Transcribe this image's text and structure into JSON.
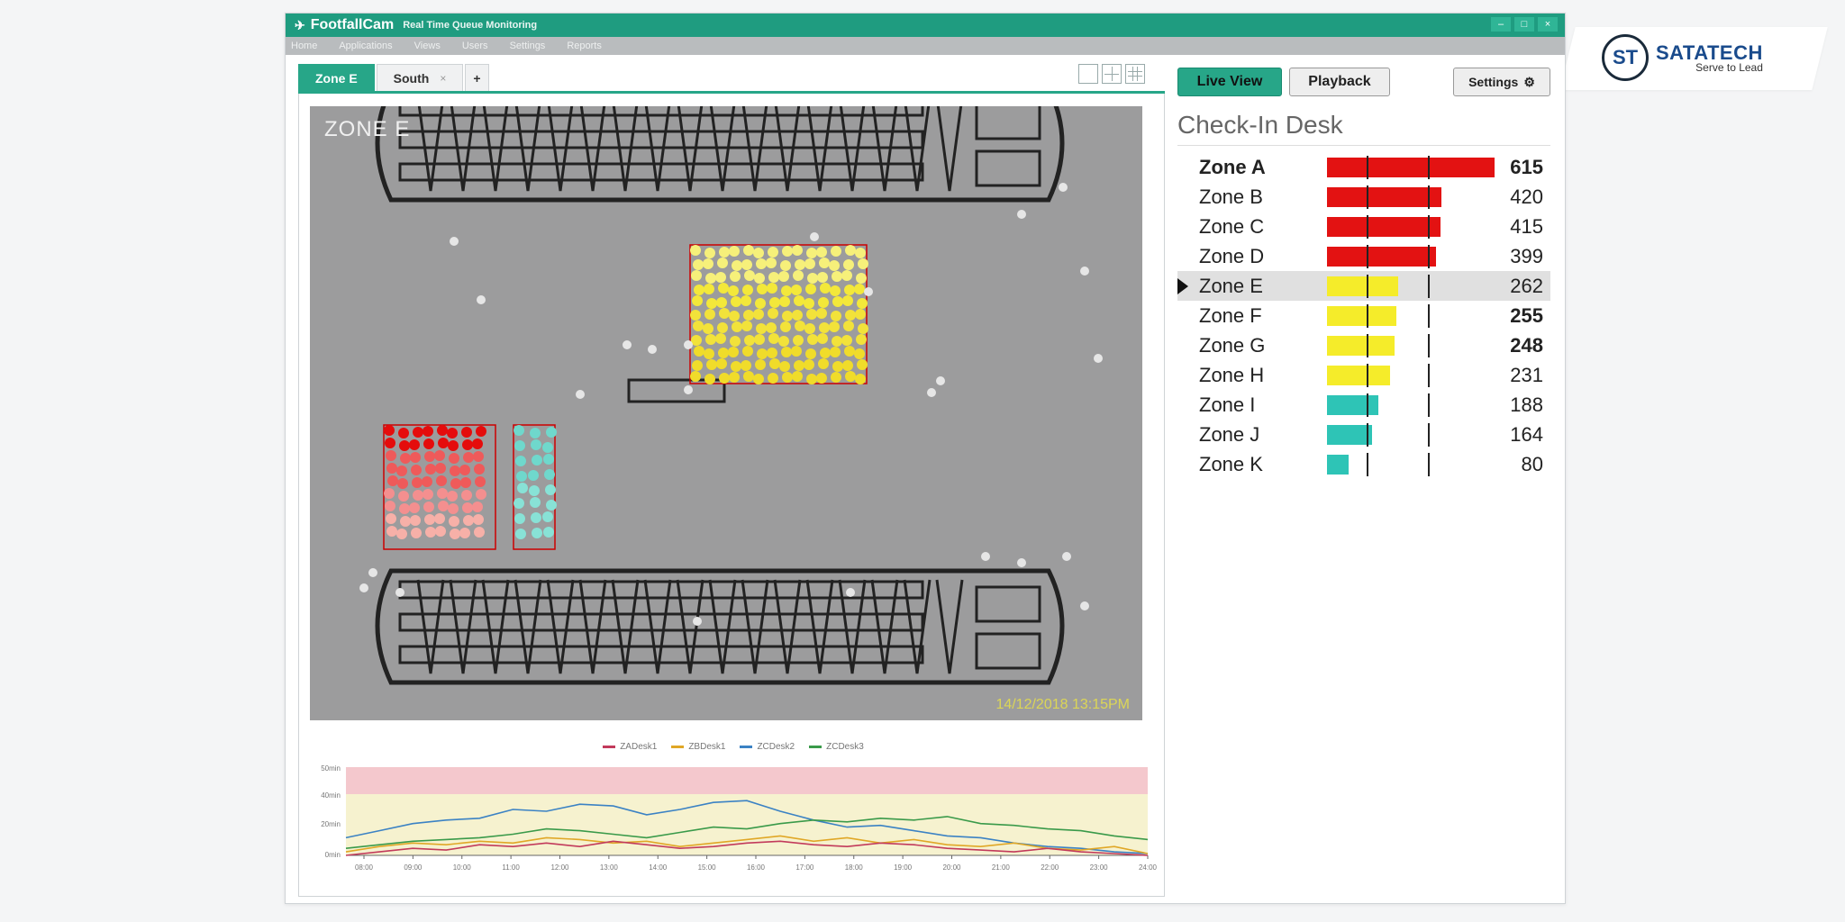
{
  "app": {
    "brand": "FootfallCam",
    "subtitle": "Real Time Queue Monitoring",
    "window_controls": [
      "–",
      "□",
      "×"
    ]
  },
  "menu": [
    "Home",
    "Applications",
    "Views",
    "Users",
    "Settings",
    "Reports"
  ],
  "tabs": [
    {
      "label": "Zone E",
      "active": true
    },
    {
      "label": "South",
      "close": "×"
    },
    {
      "label": "+"
    }
  ],
  "map": {
    "zone_label": "ZONE E",
    "timestamp": "14/12/2018 13:15PM"
  },
  "chart": {
    "legend": [
      "ZADesk1",
      "ZBDesk1",
      "ZCDesk2",
      "ZCDesk3"
    ],
    "y_labels": [
      "50min",
      "40min",
      "20min",
      "0min"
    ],
    "x_labels": [
      "08:00",
      "09:00",
      "10:00",
      "11:00",
      "12:00",
      "13:00",
      "14:00",
      "15:00",
      "16:00",
      "17:00",
      "18:00",
      "19:00",
      "20:00",
      "21:00",
      "22:00",
      "23:00",
      "24:00"
    ],
    "colors": {
      "ZADesk1": "#c23a5b",
      "ZBDesk1": "#e0a726",
      "ZCDesk2": "#3b82c4",
      "ZCDesk3": "#3a9a4a"
    }
  },
  "controls": {
    "live_view": "Live View",
    "playback": "Playback",
    "settings": "Settings"
  },
  "section_title": "Check-In Desk",
  "zones": [
    {
      "name": "Zone A",
      "value": "615",
      "color": "#e31212",
      "weight": "bold"
    },
    {
      "name": "Zone B",
      "value": "420",
      "color": "#e31212"
    },
    {
      "name": "Zone C",
      "value": "415",
      "color": "#e31212"
    },
    {
      "name": "Zone D",
      "value": "399",
      "color": "#e31212"
    },
    {
      "name": "Zone E",
      "value": "262",
      "color": "#f5ec2a",
      "selected": true
    },
    {
      "name": "Zone F",
      "value": "255",
      "color": "#f5ec2a",
      "weight": "boldval"
    },
    {
      "name": "Zone G",
      "value": "248",
      "color": "#f5ec2a",
      "weight": "boldval"
    },
    {
      "name": "Zone H",
      "value": "231",
      "color": "#f5ec2a"
    },
    {
      "name": "Zone I",
      "value": "188",
      "color": "#2ec4b6"
    },
    {
      "name": "Zone J",
      "value": "164",
      "color": "#2ec4b6"
    },
    {
      "name": "Zone K",
      "value": "80",
      "color": "#2ec4b6"
    }
  ],
  "badge": {
    "initials": "ST",
    "brand": "SATATECH",
    "tagline": "Serve to Lead"
  }
}
